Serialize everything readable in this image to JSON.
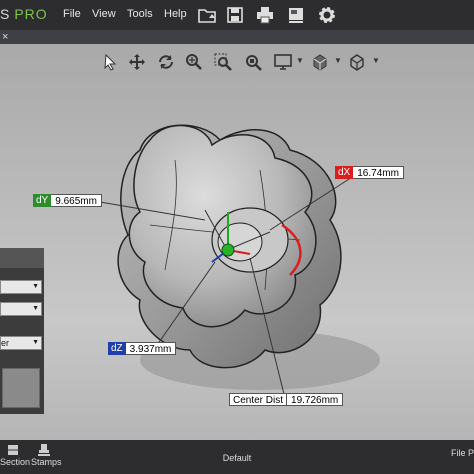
{
  "app": {
    "logo_s": "S",
    "logo_pro": "PRO"
  },
  "menu": {
    "file": "File",
    "view": "View",
    "tools": "Tools",
    "help": "Help"
  },
  "toolbar_icons": [
    "open-folder-icon",
    "save-icon",
    "print-icon",
    "screenshot-icon",
    "settings-icon"
  ],
  "tab": {
    "close": "×"
  },
  "view_tools": [
    "select-arrow-icon",
    "pan-icon",
    "rotate-icon",
    "zoom-icon",
    "zoom-window-icon",
    "zoom-fit-icon",
    "display-mode-icon",
    "view-cube-icon",
    "box-icon"
  ],
  "measurements": {
    "dx": {
      "key": "dX",
      "value": "16.74mm",
      "color": "#d81e1e"
    },
    "dy": {
      "key": "dY",
      "value": "9.665mm",
      "color": "#2e8b2e"
    },
    "dz": {
      "key": "dZ",
      "value": "3.937mm",
      "color": "#1f3fa8"
    },
    "center": {
      "key": "Center Dist",
      "value": "19.726mm"
    }
  },
  "left_panel": {
    "dropdown_3": "er"
  },
  "bottom": {
    "section": "Section",
    "stamps": "Stamps",
    "default": "Default",
    "file_partial": "File P"
  }
}
